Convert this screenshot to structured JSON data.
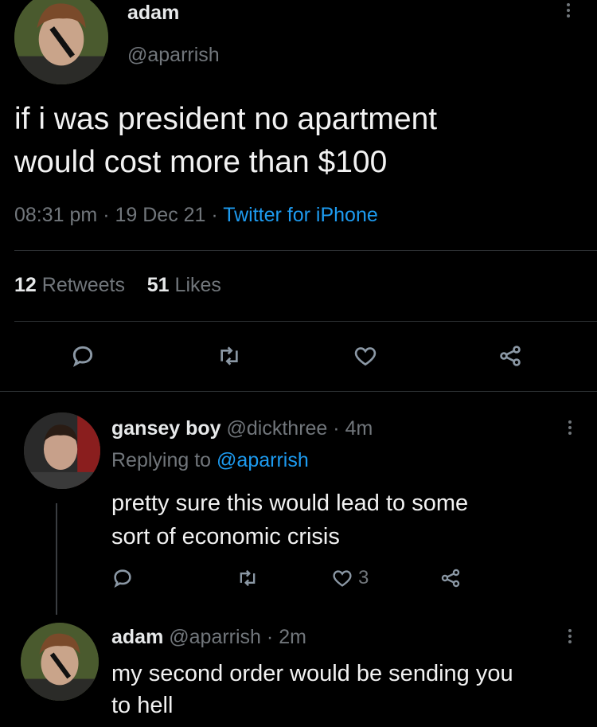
{
  "main_tweet": {
    "display_name": "adam",
    "handle": "@aparrish",
    "text_line1": "if i was president no apartment",
    "text_line2": "would cost more than $100",
    "time": "08:31 pm",
    "date": "19 Dec 21",
    "sep": "·",
    "source": "Twitter for iPhone",
    "retweets_count": "12",
    "retweets_label": "Retweets",
    "likes_count": "51",
    "likes_label": "Likes"
  },
  "reply1": {
    "display_name": "gansey boy",
    "handle": "@dickthree",
    "time": "· 4m",
    "replying_label": "Replying to",
    "replying_handle": "@aparrish",
    "text_line1": "pretty sure this would lead to some",
    "text_line2": "sort of economic crisis",
    "like_count": "3"
  },
  "reply2": {
    "display_name": "adam",
    "handle": "@aparrish",
    "time": "· 2m",
    "text_line1": "my second order would be sending you",
    "text_line2": "to hell"
  },
  "icons": {
    "reply": "speech-bubble",
    "retweet": "retweet-arrows",
    "like": "heart-outline",
    "share": "share-nodes",
    "more": "vertical-ellipsis"
  },
  "colors": {
    "background": "#000000",
    "text": "#e7e9ea",
    "muted": "#71767b",
    "link": "#1d9bf0"
  }
}
